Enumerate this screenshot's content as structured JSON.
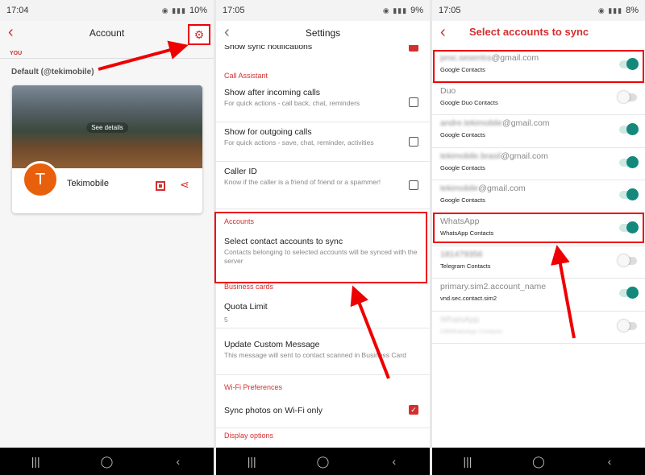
{
  "panel1": {
    "status": {
      "time": "17:04",
      "battery": "10%"
    },
    "title": "Account",
    "you_label": "YOU",
    "default_label": "Default (@tekimobile)",
    "card": {
      "see_details": "See details",
      "avatar_letter": "T",
      "name": "Tekimobile"
    }
  },
  "panel2": {
    "status": {
      "time": "17:05",
      "battery": "9%"
    },
    "title": "Settings",
    "partial_top": "Show sync notifications",
    "sections": {
      "call_assistant": "Call Assistant",
      "accounts": "Accounts",
      "business_cards": "Business cards",
      "wifi": "Wi-Fi Preferences",
      "display": "Display options"
    },
    "rows": {
      "incoming_title": "Show after incoming calls",
      "incoming_sub": "For quick actions - call back, chat, reminders",
      "outgoing_title": "Show for outgoing calls",
      "outgoing_sub": "For quick actions - save, chat, reminder, activities",
      "callerid_title": "Caller ID",
      "callerid_sub": "Know if the caller is a friend of friend or a spammer!",
      "select_title": "Select contact accounts to sync",
      "select_sub": "Contacts belonging to selected accounts will be synced with the server",
      "quota_title": "Quota Limit",
      "quota_value": "5",
      "update_title": "Update Custom Message",
      "update_sub": "This message will sent to contact scanned in Business Card",
      "wifi_title": "Sync photos on Wi-Fi only"
    }
  },
  "panel3": {
    "status": {
      "time": "17:05",
      "battery": "8%"
    },
    "title": "Select accounts to sync",
    "accounts": [
      {
        "name": "@gmail.com",
        "blur_prefix": "proc.sesentra",
        "type": "Google Contacts",
        "on": true
      },
      {
        "name": "Duo",
        "blur_prefix": "",
        "type": "Google Duo Contacts",
        "on": false
      },
      {
        "name": "@gmail.com",
        "blur_prefix": "andre.tekimobile",
        "type": "Google Contacts",
        "on": true
      },
      {
        "name": "@gmail.com",
        "blur_prefix": "tekimobile.brasil",
        "type": "Google Contacts",
        "on": true
      },
      {
        "name": "@gmail.com",
        "blur_prefix": "tekimobile",
        "type": "Google Contacts",
        "on": true
      },
      {
        "name": "WhatsApp",
        "blur_prefix": "",
        "type": "WhatsApp Contacts",
        "on": true
      },
      {
        "name": "181479356",
        "blur_prefix": "",
        "type": "Telegram Contacts",
        "on": false
      },
      {
        "name": "primary.sim2.account_name",
        "blur_prefix": "",
        "type": "vnd.sec.contact.sim2",
        "on": true
      },
      {
        "name": "WhatsApp",
        "blur_prefix": "",
        "type": "GBWhatsApp Contacts",
        "on": false
      }
    ]
  },
  "colors": {
    "accent": "#d32f2f",
    "toggle_on": "#14887b",
    "highlight": "#ee0000"
  }
}
